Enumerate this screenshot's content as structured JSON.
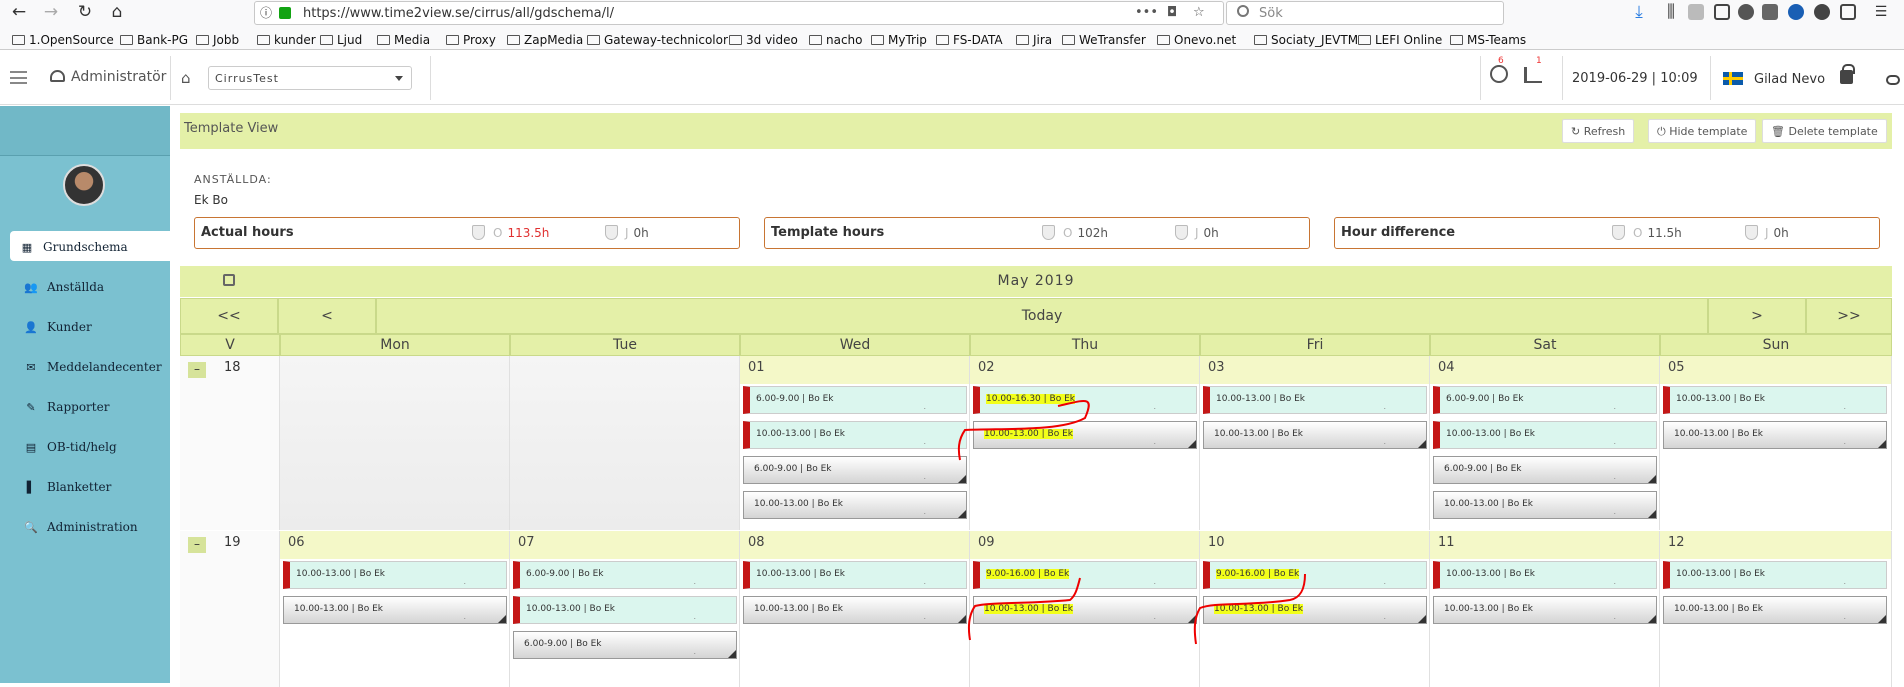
{
  "browser": {
    "url": "https://www.time2view.se/cirrus/all/gdschema/l/",
    "search_placeholder": "Sök",
    "url_actions": "•••",
    "bookmarks": [
      "1.OpenSource",
      "Bank-PG",
      "Jobb",
      "kunder",
      "Ljud",
      "Media",
      "Proxy",
      "ZapMedia",
      "Gateway-technicolor",
      "3d video",
      "nacho",
      "MyTrip",
      "FS-DATA",
      "Jira",
      "WeTransfer",
      "Onevo.net",
      "Sociaty_JEVTM",
      "LEFI Online",
      "MS-Teams"
    ]
  },
  "appbar": {
    "role": "Administratör",
    "customer_select": "CirrusTest",
    "badge_support": "6",
    "badge_stats": "1",
    "datetime": "2019-06-29 | 10:09",
    "username": "Gilad Nevo"
  },
  "sidebar": {
    "items": [
      "Grundschema",
      "Anställda",
      "Kunder",
      "Meddelandecenter",
      "Rapporter",
      "OB-tid/helg",
      "Blanketter",
      "Administration"
    ]
  },
  "template_view": {
    "title": "Template View",
    "refresh": "Refresh",
    "hide": "Hide template",
    "delete": "Delete template"
  },
  "employees": {
    "label": "ANSTÄLLDA:",
    "name": "Ek Bo",
    "stats": [
      {
        "label": "Actual hours",
        "o_prefix": "O",
        "o_value": "113.5h",
        "j_prefix": "J",
        "j_value": "0h",
        "o_color": "#e03030"
      },
      {
        "label": "Template hours",
        "o_prefix": "O",
        "o_value": "102h",
        "j_prefix": "J",
        "j_value": "0h",
        "o_color": "#555555"
      },
      {
        "label": "Hour difference",
        "o_prefix": "O",
        "o_value": "11.5h",
        "j_prefix": "J",
        "j_value": "0h",
        "o_color": "#555555"
      }
    ]
  },
  "calendar": {
    "month": "May 2019",
    "nav": {
      "first": "<<",
      "prev": "<",
      "today": "Today",
      "next": ">",
      "last": ">>"
    },
    "week_col": "V",
    "days": [
      "Mon",
      "Tue",
      "Wed",
      "Thu",
      "Fri",
      "Sat",
      "Sun"
    ],
    "weeks": [
      {
        "number": "18",
        "toggle": "–",
        "dates": [
          "",
          "",
          "01",
          "02",
          "03",
          "04",
          "05"
        ],
        "shifts": [
          [],
          [],
          [
            {
              "text": "6.00-9.00 |  Bo Ek",
              "kind": "mint"
            },
            {
              "text": "10.00-13.00 |  Bo Ek",
              "kind": "mint"
            },
            {
              "text": "6.00-9.00 |  Bo Ek",
              "kind": "gray"
            },
            {
              "text": "10.00-13.00 |  Bo Ek",
              "kind": "gray"
            }
          ],
          [
            {
              "text": "10.00-16.30 |  Bo Ek",
              "kind": "mint",
              "hl": true
            },
            {
              "text": "10.00-13.00 |  Bo Ek",
              "kind": "gray",
              "hl": true
            }
          ],
          [
            {
              "text": "10.00-13.00 |  Bo Ek",
              "kind": "mint"
            },
            {
              "text": "10.00-13.00 |  Bo Ek",
              "kind": "gray"
            }
          ],
          [
            {
              "text": "6.00-9.00 |  Bo Ek",
              "kind": "mint"
            },
            {
              "text": "10.00-13.00 |  Bo Ek",
              "kind": "mint"
            },
            {
              "text": "6.00-9.00 |  Bo Ek",
              "kind": "gray"
            },
            {
              "text": "10.00-13.00 |  Bo Ek",
              "kind": "gray"
            }
          ],
          [
            {
              "text": "10.00-13.00 |  Bo Ek",
              "kind": "mint"
            },
            {
              "text": "10.00-13.00 |  Bo Ek",
              "kind": "gray"
            }
          ]
        ]
      },
      {
        "number": "19",
        "toggle": "–",
        "dates": [
          "06",
          "07",
          "08",
          "09",
          "10",
          "11",
          "12"
        ],
        "shifts": [
          [
            {
              "text": "10.00-13.00 |  Bo Ek",
              "kind": "mint"
            },
            {
              "text": "10.00-13.00 |  Bo Ek",
              "kind": "gray"
            }
          ],
          [
            {
              "text": "6.00-9.00 |  Bo Ek",
              "kind": "mint"
            },
            {
              "text": "10.00-13.00 |  Bo Ek",
              "kind": "mint"
            },
            {
              "text": "6.00-9.00 |  Bo Ek",
              "kind": "gray"
            }
          ],
          [
            {
              "text": "10.00-13.00 |  Bo Ek",
              "kind": "mint"
            },
            {
              "text": "10.00-13.00 |  Bo Ek",
              "kind": "gray"
            }
          ],
          [
            {
              "text": "9.00-16.00 |  Bo Ek",
              "kind": "mint",
              "hl": true
            },
            {
              "text": "10.00-13.00 |  Bo Ek",
              "kind": "gray",
              "hl": true
            }
          ],
          [
            {
              "text": "9.00-16.00 |  Bo Ek",
              "kind": "mint",
              "hl": true
            },
            {
              "text": "10.00-13.00 |  Bo Ek",
              "kind": "gray",
              "hl": true
            }
          ],
          [
            {
              "text": "10.00-13.00 |  Bo Ek",
              "kind": "mint"
            },
            {
              "text": "10.00-13.00 |  Bo Ek",
              "kind": "gray"
            }
          ],
          [
            {
              "text": "10.00-13.00 |  Bo Ek",
              "kind": "mint"
            },
            {
              "text": "10.00-13.00 |  Bo Ek",
              "kind": "gray"
            }
          ]
        ]
      }
    ]
  }
}
